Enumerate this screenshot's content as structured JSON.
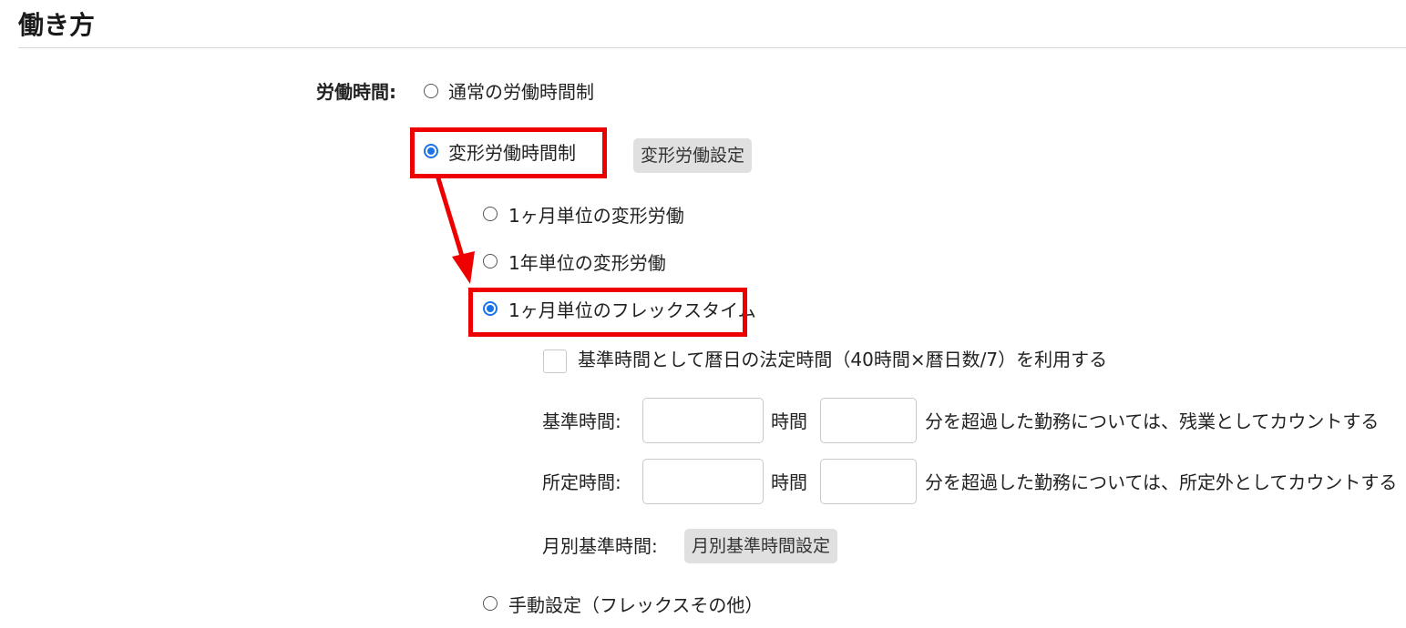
{
  "section": {
    "title": "働き方"
  },
  "working_hours": {
    "label": "労働時間:",
    "options": {
      "normal": {
        "label": "通常の労働時間制",
        "checked": false
      },
      "variable": {
        "label": "変形労働時間制",
        "checked": true,
        "settings_button": "変形労働設定"
      },
      "manual": {
        "label": "手動設定（フレックスその他）",
        "checked": false
      }
    },
    "variable_types": {
      "monthly": {
        "label": "1ヶ月単位の変形労働",
        "checked": false
      },
      "yearly": {
        "label": "1年単位の変形労働",
        "checked": false
      },
      "flex": {
        "label": "1ヶ月単位のフレックスタイム",
        "checked": true
      }
    },
    "flex": {
      "legal_hours_checkbox_label": "基準時間として暦日の法定時間（40時間×暦日数/7）を利用する",
      "legal_hours_checked": false,
      "standard_time": {
        "label": "基準時間:",
        "hours_unit": "時間",
        "hours_value": "",
        "minutes_value": "",
        "suffix": "分を超過した勤務については、残業としてカウントする"
      },
      "scheduled_time": {
        "label": "所定時間:",
        "hours_unit": "時間",
        "hours_value": "",
        "minutes_value": "",
        "suffix": "分を超過した勤務については、所定外としてカウントする"
      },
      "monthly_standard": {
        "label": "月別基準時間:",
        "button": "月別基準時間設定"
      }
    }
  },
  "annotation": {
    "highlight_color": "#ee0000"
  },
  "colors": {
    "radio_checked": "#1a73e8",
    "button_bg": "#e0e0e0",
    "rule": "#d8d8d8"
  }
}
